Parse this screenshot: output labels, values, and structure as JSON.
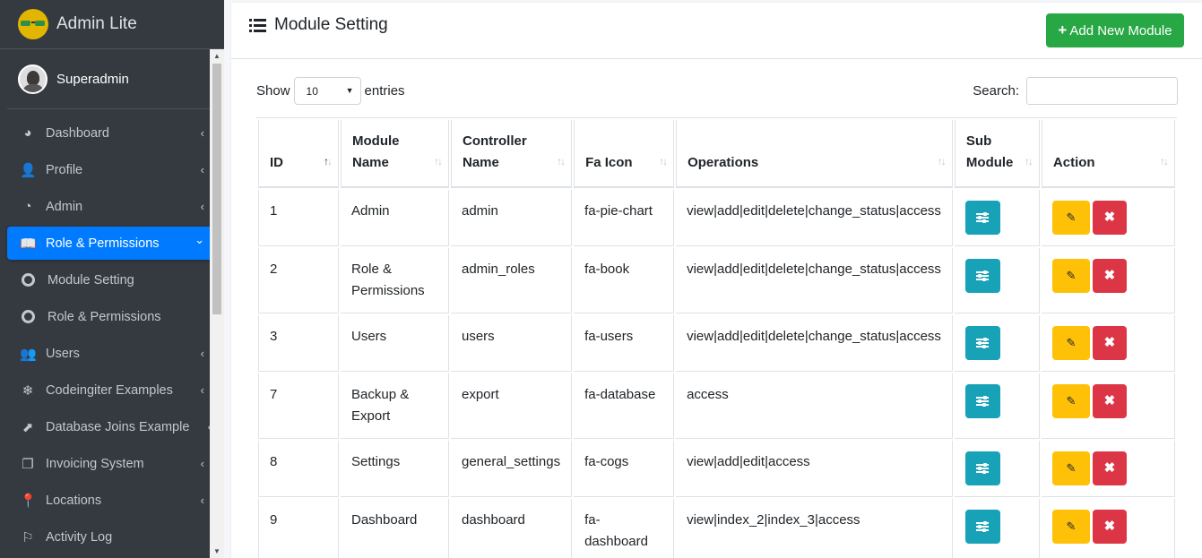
{
  "brand": {
    "name": "Admin Lite"
  },
  "user": {
    "name": "Superadmin"
  },
  "sidebar": {
    "items": [
      {
        "label": "Dashboard",
        "icon": "tachometer-icon",
        "glyph": "◕",
        "chevron": "‹"
      },
      {
        "label": "Profile",
        "icon": "user-icon",
        "glyph": "👤",
        "chevron": "‹"
      },
      {
        "label": "Admin",
        "icon": "pie-chart-icon",
        "glyph": "◔",
        "chevron": "‹"
      },
      {
        "label": "Role & Permissions",
        "icon": "book-icon",
        "glyph": "📖",
        "chevron": "⌄"
      },
      {
        "label": "Module Setting",
        "icon": "circle-icon"
      },
      {
        "label": "Role & Permissions",
        "icon": "circle-icon"
      },
      {
        "label": "Users",
        "icon": "users-icon",
        "glyph": "👥",
        "chevron": "‹"
      },
      {
        "label": "Codeingiter Examples",
        "icon": "snowflake-icon",
        "glyph": "❄",
        "chevron": "‹"
      },
      {
        "label": "Database Joins Example",
        "icon": "external-link-icon",
        "glyph": "⬈",
        "chevron": "‹"
      },
      {
        "label": "Invoicing System",
        "icon": "copy-icon",
        "glyph": "❐",
        "chevron": "‹"
      },
      {
        "label": "Locations",
        "icon": "map-pin-icon",
        "glyph": "📍",
        "chevron": "‹"
      },
      {
        "label": "Activity Log",
        "icon": "flag-icon",
        "glyph": "⚐"
      }
    ]
  },
  "header": {
    "title": "Module Setting",
    "add_button": "Add New Module",
    "add_glyph": "+"
  },
  "controls": {
    "show_label": "Show",
    "entries_value": "10",
    "entries_label": "entries",
    "search_label": "Search:",
    "search_value": ""
  },
  "table": {
    "headers": [
      "ID",
      "Module Name",
      "Controller Name",
      "Fa Icon",
      "Operations",
      "Sub Module",
      "Action"
    ],
    "sorted_column": "ID",
    "rows": [
      {
        "id": "1",
        "module": "Admin",
        "controller": "admin",
        "icon": "fa-pie-chart",
        "operations": "view|add|edit|delete|change_status|access"
      },
      {
        "id": "2",
        "module": "Role & Permissions",
        "controller": "admin_roles",
        "icon": "fa-book",
        "operations": "view|add|edit|delete|change_status|access"
      },
      {
        "id": "3",
        "module": "Users",
        "controller": "users",
        "icon": "fa-users",
        "operations": "view|add|edit|delete|change_status|access"
      },
      {
        "id": "7",
        "module": "Backup & Export",
        "controller": "export",
        "icon": "fa-database",
        "operations": "access"
      },
      {
        "id": "8",
        "module": "Settings",
        "controller": "general_settings",
        "icon": "fa-cogs",
        "operations": "view|add|edit|access"
      },
      {
        "id": "9",
        "module": "Dashboard",
        "controller": "dashboard",
        "icon": "fa-dashboard",
        "operations": "view|index_2|index_3|access"
      }
    ]
  },
  "colors": {
    "sidebar_bg": "#343a40",
    "active": "#007bff",
    "success": "#28a745",
    "info": "#17a2b8",
    "warning": "#ffc107",
    "danger": "#dc3545"
  }
}
